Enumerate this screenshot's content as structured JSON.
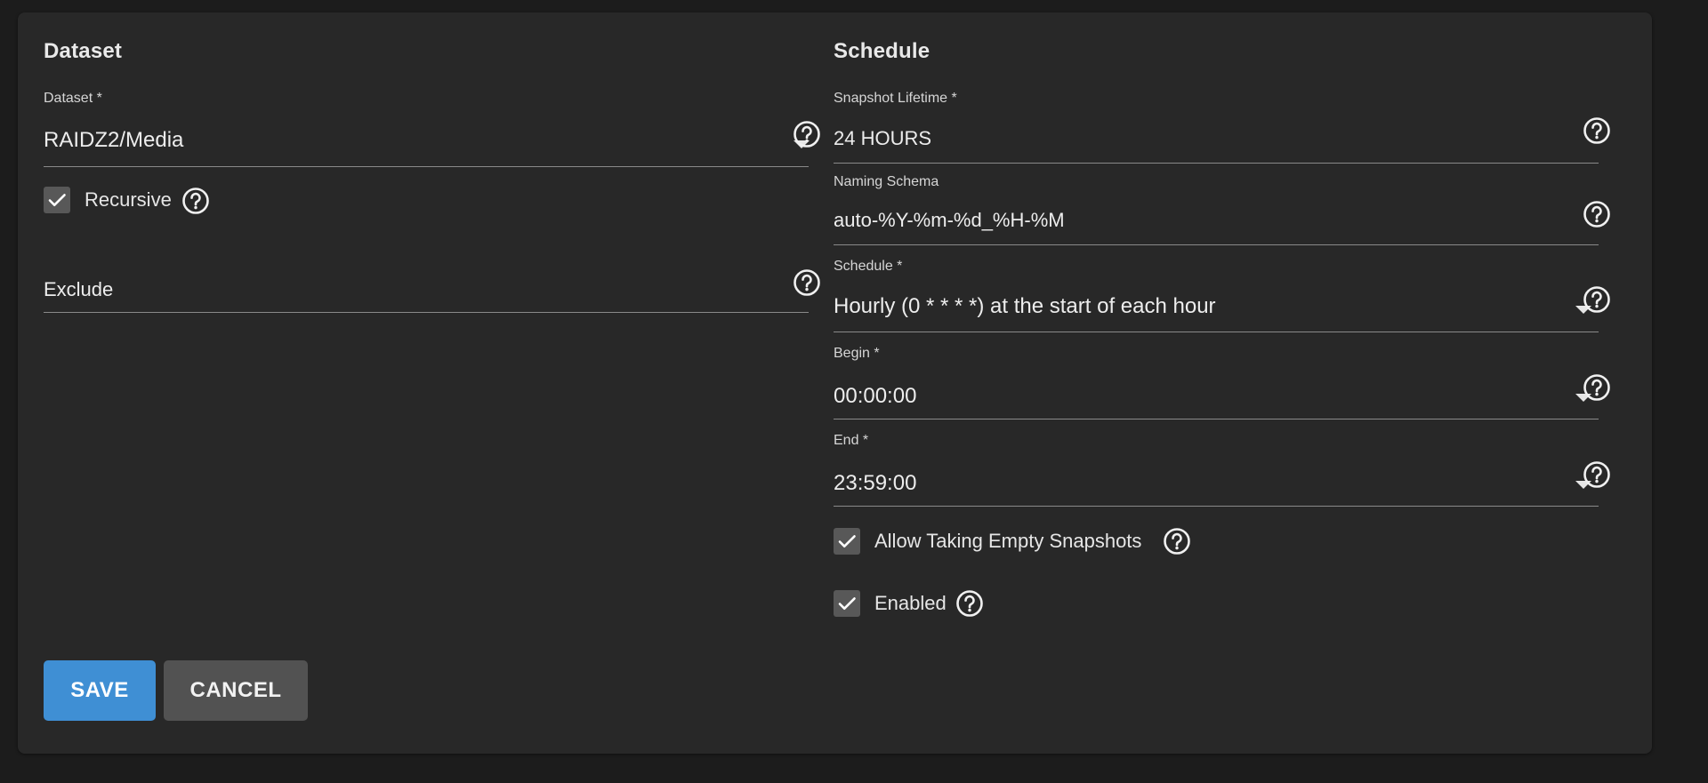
{
  "dataset_section": {
    "title": "Dataset",
    "dataset": {
      "label": "Dataset *",
      "value": "RAIDZ2/Media"
    },
    "recursive": {
      "label": "Recursive",
      "checked": true
    },
    "exclude": {
      "label": "Exclude",
      "value": ""
    }
  },
  "schedule_section": {
    "title": "Schedule",
    "snapshot_lifetime": {
      "label": "Snapshot Lifetime *",
      "value": "24 HOURS"
    },
    "naming_schema": {
      "label": "Naming Schema",
      "value": "auto-%Y-%m-%d_%H-%M"
    },
    "schedule": {
      "label": "Schedule *",
      "value": "Hourly (0 * * * *) at the start of each hour"
    },
    "begin": {
      "label": "Begin *",
      "value": "00:00:00"
    },
    "end": {
      "label": "End *",
      "value": "23:59:00"
    },
    "allow_empty": {
      "label": "Allow Taking Empty Snapshots",
      "checked": true
    },
    "enabled": {
      "label": "Enabled",
      "checked": true
    }
  },
  "actions": {
    "save_label": "SAVE",
    "cancel_label": "CANCEL"
  },
  "icons": {
    "help": "help-circle-icon",
    "dropdown": "dropdown-arrow-icon",
    "check": "check-icon"
  },
  "colors": {
    "background": "#1c1c1c",
    "card": "#282828",
    "primary": "#3f8fd4",
    "secondary_button": "#525252",
    "checkbox": "#585858"
  }
}
